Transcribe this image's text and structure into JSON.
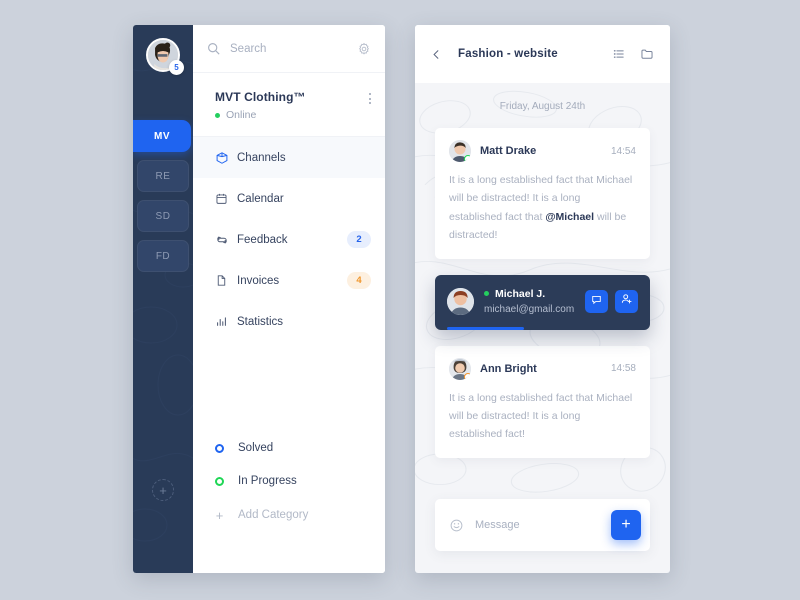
{
  "workspace_rail": {
    "avatar": {
      "name": "user-avatar",
      "badge": "5"
    },
    "items": [
      {
        "label": "MV",
        "active": true
      },
      {
        "label": "RE",
        "active": false
      },
      {
        "label": "SD",
        "active": false
      },
      {
        "label": "FD",
        "active": false
      }
    ],
    "add_label": "+"
  },
  "search": {
    "placeholder": "Search",
    "icon": "search-icon",
    "settings_icon": "gear-icon"
  },
  "organization": {
    "name": "MVT Clothing™",
    "status": "Online",
    "status_color": "#24cf5f",
    "menu_icon": "kebab-menu-icon"
  },
  "nav": {
    "items": [
      {
        "label": "Channels",
        "icon": "cube-icon",
        "badge": "",
        "active": true
      },
      {
        "label": "Calendar",
        "icon": "calendar-icon",
        "badge": "",
        "active": false
      },
      {
        "label": "Feedback",
        "icon": "refresh-icon",
        "badge": "2",
        "badge_style": "blue",
        "active": false
      },
      {
        "label": "Invoices",
        "icon": "document-icon",
        "badge": "4",
        "badge_style": "orange",
        "active": false
      },
      {
        "label": "Statistics",
        "icon": "bar-chart-icon",
        "badge": "",
        "active": false
      }
    ]
  },
  "categories": {
    "items": [
      {
        "label": "Solved",
        "color": "#1f64f0"
      },
      {
        "label": "In Progress",
        "color": "#1fd655"
      }
    ],
    "add_label": "Add Category",
    "add_icon": "plus-icon"
  },
  "chat": {
    "header": {
      "back_icon": "chevron-left-icon",
      "title": "Fashion - website",
      "list_icon": "list-icon",
      "folder_icon": "folder-icon"
    },
    "date_separator": "Friday, August 24th",
    "messages": [
      {
        "author": "Matt Drake",
        "time": "14:54",
        "presence": "green",
        "text_before": "It is a long established fact that Michael will be distracted! It is a long established fact that ",
        "mention": "@Michael",
        "text_after": " will be distracted!"
      },
      {
        "author": "Ann Bright",
        "time": "14:58",
        "presence": "orange",
        "text_before": "It is a long established fact that Michael will be distracted! It is a long established fact!",
        "mention": "",
        "text_after": ""
      }
    ],
    "contact_card": {
      "name": "Michael J.",
      "email": "michael@gmail.com",
      "status_color": "#24cf5f",
      "message_icon": "chat-bubble-icon",
      "add_user_icon": "add-person-icon"
    },
    "composer": {
      "emoji_icon": "smiley-icon",
      "placeholder": "Message",
      "send_label": "+",
      "send_icon": "plus-icon"
    }
  },
  "theme": {
    "accent": "#1f64f0",
    "sidebar_dark": "#293b58",
    "page_bg": "#ccd2dc",
    "chat_bg": "#f4f5f8",
    "badge_blue": "#e7eefd",
    "badge_orange": "#fdf0e0"
  }
}
